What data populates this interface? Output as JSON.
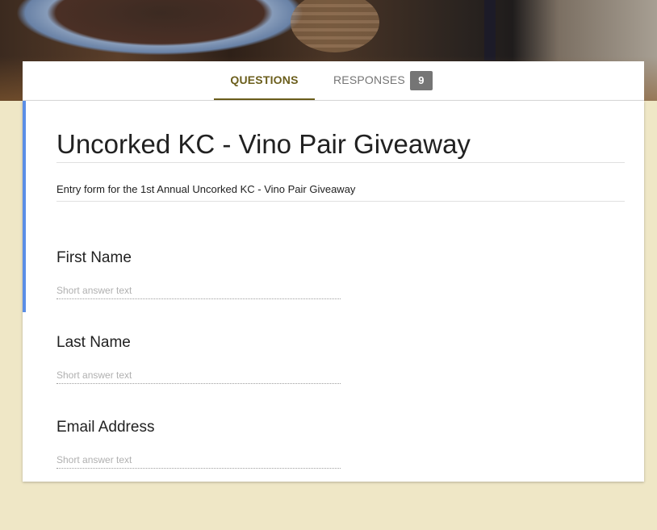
{
  "tabs": {
    "questions_label": "QUESTIONS",
    "responses_label": "RESPONSES",
    "responses_count": "9"
  },
  "form": {
    "title": "Uncorked KC - Vino Pair Giveaway",
    "description": "Entry form for the 1st Annual Uncorked KC - Vino Pair Giveaway",
    "questions": [
      {
        "label": "First Name",
        "placeholder": "Short answer text"
      },
      {
        "label": "Last Name",
        "placeholder": "Short answer text"
      },
      {
        "label": "Email Address",
        "placeholder": "Short answer text"
      }
    ]
  },
  "colors": {
    "background": "#efe7c6",
    "accent": "#6b5e1c",
    "active_section_bar": "#5b8ee6",
    "badge": "#757575"
  }
}
